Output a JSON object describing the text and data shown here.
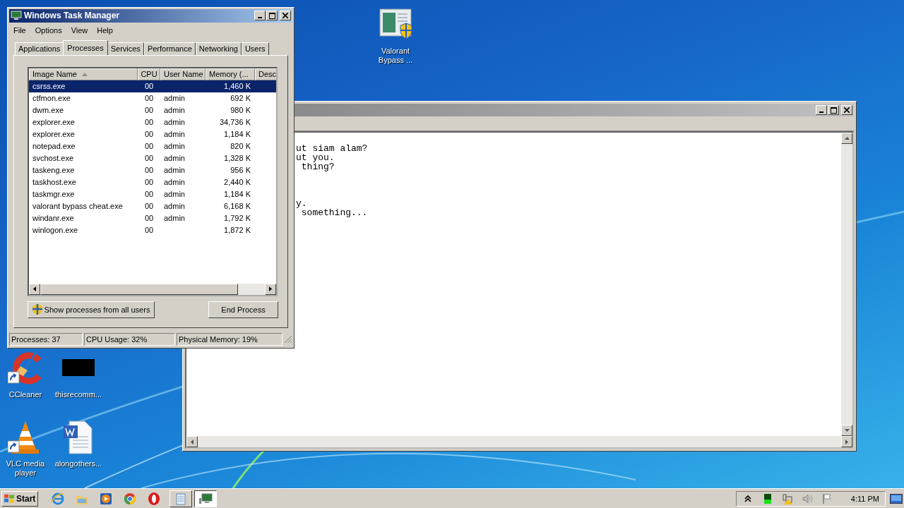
{
  "desktop_icons": [
    {
      "label": "Valorant Bypass ...",
      "kind": "shield-app",
      "shortcut": false
    },
    {
      "label": "CCleaner",
      "kind": "cleaner",
      "shortcut": true
    },
    {
      "label": "thisrecomm...",
      "kind": "thumbnail",
      "shortcut": false
    },
    {
      "label": "VLC media player",
      "kind": "cone",
      "shortcut": true
    },
    {
      "label": "alongothers...",
      "kind": "document",
      "shortcut": false
    }
  ],
  "notepad": {
    "text": "ut siam alam?\nut you.\n thing?\n\n\n\ny.\n something..."
  },
  "task_manager": {
    "title": "Windows Task Manager",
    "menu": [
      "File",
      "Options",
      "View",
      "Help"
    ],
    "tabs": [
      {
        "label": "Applications",
        "selected": false
      },
      {
        "label": "Processes",
        "selected": true
      },
      {
        "label": "Services",
        "selected": false
      },
      {
        "label": "Performance",
        "selected": false
      },
      {
        "label": "Networking",
        "selected": false
      },
      {
        "label": "Users",
        "selected": false
      }
    ],
    "columns": [
      {
        "label": "Image Name",
        "sorted": true
      },
      {
        "label": "CPU",
        "sorted": false
      },
      {
        "label": "User Name",
        "sorted": false
      },
      {
        "label": "Memory (...",
        "sorted": false
      },
      {
        "label": "Desc",
        "sorted": false
      }
    ],
    "rows": [
      {
        "image_name": "csrss.exe",
        "cpu": "00",
        "memory": "1,460 K",
        "selected": true
      },
      {
        "image_name": "ctfmon.exe",
        "cpu": "00",
        "user_name": "admin",
        "memory": "692 K",
        "selected": false
      },
      {
        "image_name": "dwm.exe",
        "cpu": "00",
        "user_name": "admin",
        "memory": "980 K",
        "selected": false
      },
      {
        "image_name": "explorer.exe",
        "cpu": "00",
        "user_name": "admin",
        "memory": "34,736 K",
        "selected": false
      },
      {
        "image_name": "explorer.exe",
        "cpu": "00",
        "user_name": "admin",
        "memory": "1,184 K",
        "selected": false
      },
      {
        "image_name": "notepad.exe",
        "cpu": "00",
        "user_name": "admin",
        "memory": "820 K",
        "selected": false
      },
      {
        "image_name": "svchost.exe",
        "cpu": "00",
        "user_name": "admin",
        "memory": "1,328 K",
        "selected": false
      },
      {
        "image_name": "taskeng.exe",
        "cpu": "00",
        "user_name": "admin",
        "memory": "956 K",
        "selected": false
      },
      {
        "image_name": "taskhost.exe",
        "cpu": "00",
        "user_name": "admin",
        "memory": "2,440 K",
        "selected": false
      },
      {
        "image_name": "taskmgr.exe",
        "cpu": "00",
        "user_name": "admin",
        "memory": "1,184 K",
        "selected": false
      },
      {
        "image_name": "valorant bypass cheat.exe",
        "cpu": "00",
        "user_name": "admin",
        "memory": "6,168 K",
        "selected": false
      },
      {
        "image_name": "windanr.exe",
        "cpu": "00",
        "user_name": "admin",
        "memory": "1,792 K",
        "selected": false
      },
      {
        "image_name": "winlogon.exe",
        "cpu": "00",
        "memory": "1,872 K",
        "selected": false
      }
    ],
    "buttons": [
      {
        "label": "Show processes from all users",
        "kind": "shield"
      },
      {
        "label": "End Process",
        "kind": "plain"
      }
    ],
    "status_bar": [
      "Processes: 37",
      "CPU Usage: 32%",
      "Physical Memory: 19%"
    ]
  },
  "taskbar": {
    "start": "Start",
    "quick_launch": [
      {
        "kind": "e-logo"
      },
      {
        "kind": "folder"
      },
      {
        "kind": "play"
      },
      {
        "kind": "ring"
      },
      {
        "kind": "o-logo"
      }
    ],
    "tasks": [
      {
        "kind": "notepad",
        "selected": false
      },
      {
        "kind": "monitor",
        "selected": true
      }
    ],
    "tray": [
      {
        "kind": "chevron"
      },
      {
        "kind": "meter"
      },
      {
        "kind": "network-warning"
      },
      {
        "kind": "speaker"
      },
      {
        "kind": "flag"
      }
    ],
    "clock": "4:11 PM"
  }
}
